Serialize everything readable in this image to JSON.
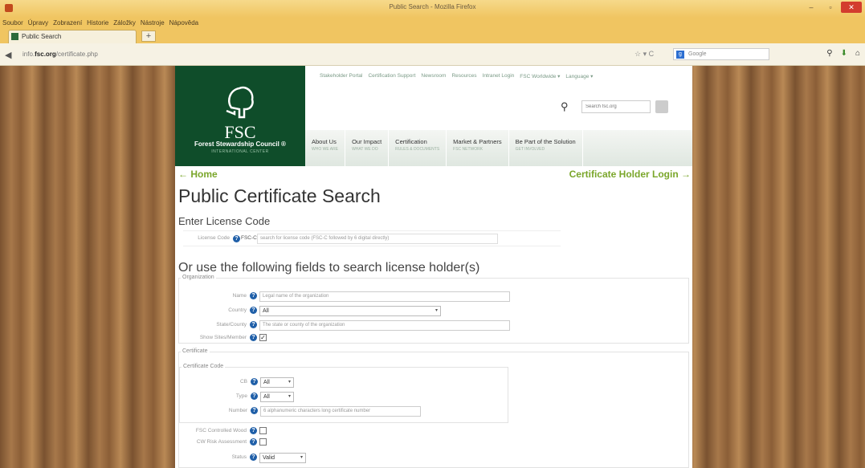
{
  "window": {
    "title": "Public Search - Mozilla Firefox",
    "controls": [
      "–",
      "▫",
      "✕"
    ]
  },
  "menu": [
    "Soubor",
    "Úpravy",
    "Zobrazení",
    "Historie",
    "Záložky",
    "Nástroje",
    "Nápověda"
  ],
  "tab": {
    "label": "Public Search",
    "new_tab": "+"
  },
  "navbar": {
    "url_prefix": "info.",
    "url_host": "fsc.org",
    "url_path": "/certificate.php",
    "search_placeholder": "Google"
  },
  "site": {
    "logo_text": "FSC",
    "logo_name": "Forest Stewardship Council ®",
    "logo_sub": "INTERNATIONAL CENTER",
    "top_links": [
      "Stakeholder Portal",
      "Certification Support",
      "Newsroom",
      "Resources",
      "Intranet Login",
      "FSC Worldwide ▾",
      "Language ▾"
    ],
    "search_placeholder": "Search fsc.org",
    "main_nav": [
      {
        "title": "About Us",
        "sub": "WHO WE ARE"
      },
      {
        "title": "Our Impact",
        "sub": "WHAT WE DO"
      },
      {
        "title": "Certification",
        "sub": "RULES & DOCUMENTS"
      },
      {
        "title": "Market & Partners",
        "sub": "FSC NETWORK"
      },
      {
        "title": "Be Part of the Solution",
        "sub": "GET INVOLVED"
      }
    ],
    "home_link": "← Home",
    "login_link": "Certificate Holder Login →"
  },
  "form": {
    "title": "Public Certificate Search",
    "license_heading": "Enter License Code",
    "license_label": "License Code",
    "license_prefix": "FSC-C",
    "license_placeholder": "search for license code (FSC-C followed by 6 digital directly)",
    "search_heading": "Or use the following fields to search license holder(s)",
    "organization_legend": "Organization",
    "name_label": "Name",
    "name_placeholder": "Legal name of the organization",
    "country_label": "Country",
    "country_value": "All",
    "state_label": "State/County",
    "state_placeholder": "The state or county of the organization",
    "show_member_label": "Show Sites/Member",
    "show_member_check": "✓",
    "certificate_legend": "Certificate",
    "code_legend": "Certificate Code",
    "cb_label": "CB",
    "cb_value": "All",
    "type_label": "Type",
    "type_value": "All",
    "number_label": "Number",
    "number_placeholder": "6 alphanumeric characters long certificate number",
    "fsc_wood_label": "FSC Controlled Wood",
    "cw_risk_label": "CW Risk Assessment",
    "status_label": "Status",
    "status_value": "Valid"
  }
}
